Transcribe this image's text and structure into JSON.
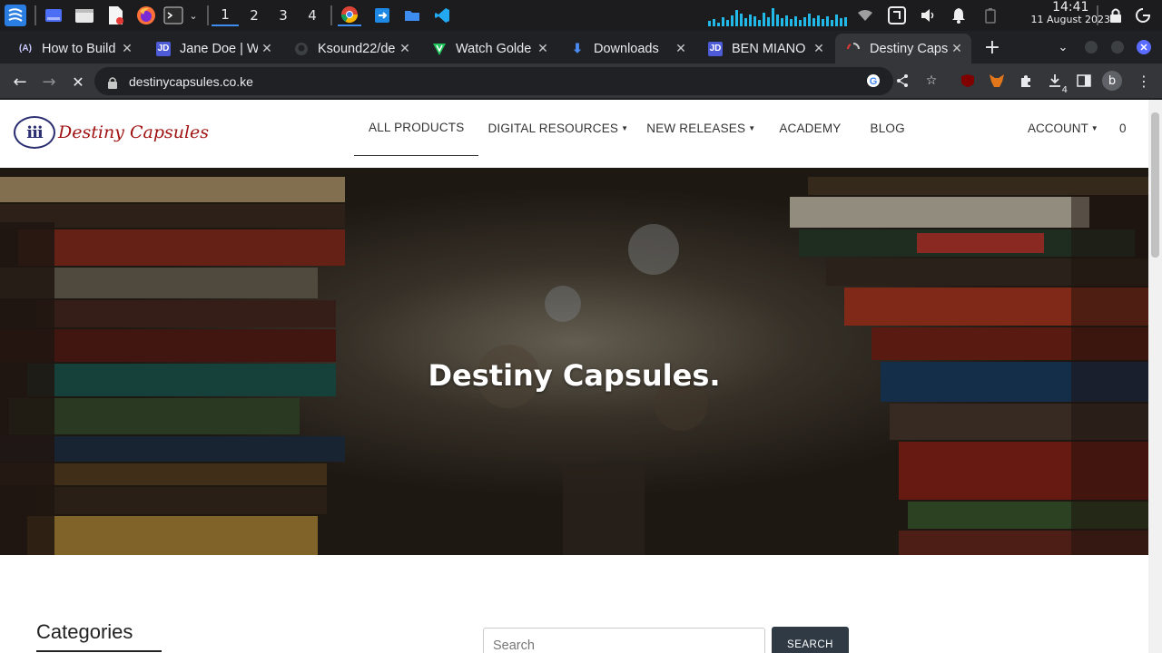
{
  "taskbar": {
    "workspaces": [
      "1",
      "2",
      "3",
      "4"
    ],
    "active_workspace": "1",
    "clock_time": "14:41",
    "clock_date": "11 August 2023",
    "icons": [
      "app-menu-icon",
      "workspace-overview-icon",
      "file-manager-icon",
      "text-editor-icon",
      "firefox-icon",
      "terminal-icon",
      "chrome-icon",
      "remote-desktop-icon",
      "folder-icon",
      "vscode-icon",
      "network-graph-icon",
      "wifi-icon",
      "screen-capture-icon",
      "volume-icon",
      "notifications-icon",
      "battery-icon",
      "lock-icon",
      "power-icon"
    ]
  },
  "browser": {
    "tabs": [
      {
        "title": "How to Build",
        "favicon": "A"
      },
      {
        "title": "Jane Doe | W",
        "favicon": "JD"
      },
      {
        "title": "Ksound22/de",
        "favicon": "gh"
      },
      {
        "title": "Watch Golde",
        "favicon": "V"
      },
      {
        "title": "Downloads",
        "favicon": "dl"
      },
      {
        "title": "BEN MIANO |",
        "favicon": "JD"
      },
      {
        "title": "Destiny Caps",
        "favicon": "dc"
      }
    ],
    "active_tab": 6,
    "url": "destinycapsules.co.ke",
    "extension_badge": "4",
    "profile_initial": "b"
  },
  "site": {
    "logo_mark": "iii",
    "logo_text": "Destiny Capsules",
    "menu": [
      {
        "label": "ALL PRODUCTS",
        "dropdown": false
      },
      {
        "label": "DIGITAL RESOURCES",
        "dropdown": true
      },
      {
        "label": "NEW RELEASES",
        "dropdown": true
      },
      {
        "label": "ACADEMY",
        "dropdown": false
      },
      {
        "label": "BLOG",
        "dropdown": false
      }
    ],
    "account_label": "ACCOUNT",
    "cart_count": "0",
    "hero_title": "Destiny Capsules.",
    "categories_heading": "Categories",
    "search_placeholder": "Search",
    "search_button": "SEARCH"
  },
  "colors": {
    "logo_red": "#a11212",
    "logo_blue": "#2b2f72",
    "search_button_bg": "#2f3a45",
    "tab_active_bg": "#35363a",
    "tabstrip_bg": "#202124"
  }
}
